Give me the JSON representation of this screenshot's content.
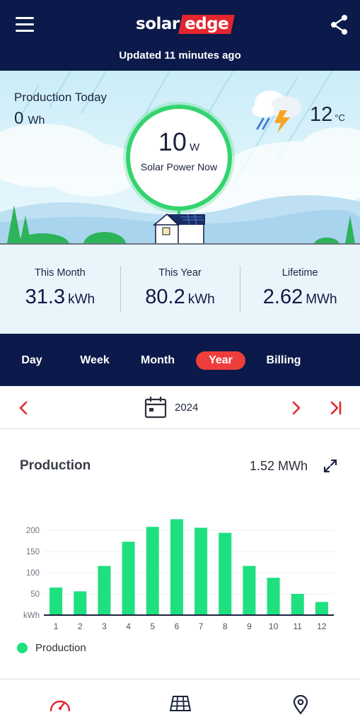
{
  "header": {
    "logo_part1": "solar",
    "logo_part2": "edge",
    "updated_text": "Updated 11 minutes ago",
    "menu_icon": "menu-icon",
    "share_icon": "share-icon"
  },
  "hero": {
    "production_today_label": "Production Today",
    "production_today_value": "0",
    "production_today_unit": "Wh",
    "solar_power_value": "10",
    "solar_power_unit": "W",
    "solar_power_label": "Solar Power Now",
    "temperature_value": "12",
    "temperature_unit": "°C",
    "weather_icon": "thunderstorm-icon"
  },
  "stats": [
    {
      "label": "This Month",
      "value": "31.3",
      "unit": "kWh"
    },
    {
      "label": "This Year",
      "value": "80.2",
      "unit": "kWh"
    },
    {
      "label": "Lifetime",
      "value": "2.62",
      "unit": "MWh"
    }
  ],
  "tabs": [
    {
      "label": "Day",
      "active": false
    },
    {
      "label": "Week",
      "active": false
    },
    {
      "label": "Month",
      "active": false
    },
    {
      "label": "Year",
      "active": true
    },
    {
      "label": "Billing",
      "active": false
    }
  ],
  "period": {
    "label": "2024",
    "prev_icon": "chevron-left-icon",
    "calendar_icon": "calendar-icon",
    "next_icon": "chevron-right-icon",
    "last_icon": "skip-to-end-icon"
  },
  "production_card": {
    "title": "Production",
    "total": "1.52 MWh",
    "expand_icon": "expand-icon",
    "legend_label": "Production"
  },
  "chart_data": {
    "type": "bar",
    "categories": [
      "1",
      "2",
      "3",
      "4",
      "5",
      "6",
      "7",
      "8",
      "9",
      "10",
      "11",
      "12"
    ],
    "values": [
      65,
      56,
      116,
      173,
      208,
      226,
      206,
      194,
      116,
      88,
      50,
      31
    ],
    "ylabel": "kWh",
    "yticks": [
      50,
      100,
      150,
      200
    ],
    "ylim": [
      0,
      240
    ],
    "grid": true,
    "color": "#1ee07f",
    "legend": "bottom-left"
  },
  "bottom_nav": [
    {
      "icon": "dashboard-gauge-icon"
    },
    {
      "icon": "solar-panel-layout-icon"
    },
    {
      "icon": "location-pin-icon"
    }
  ],
  "colors": {
    "navy": "#0b1a4a",
    "accent_red": "#ee3e3b",
    "production_green": "#1ee07f"
  }
}
